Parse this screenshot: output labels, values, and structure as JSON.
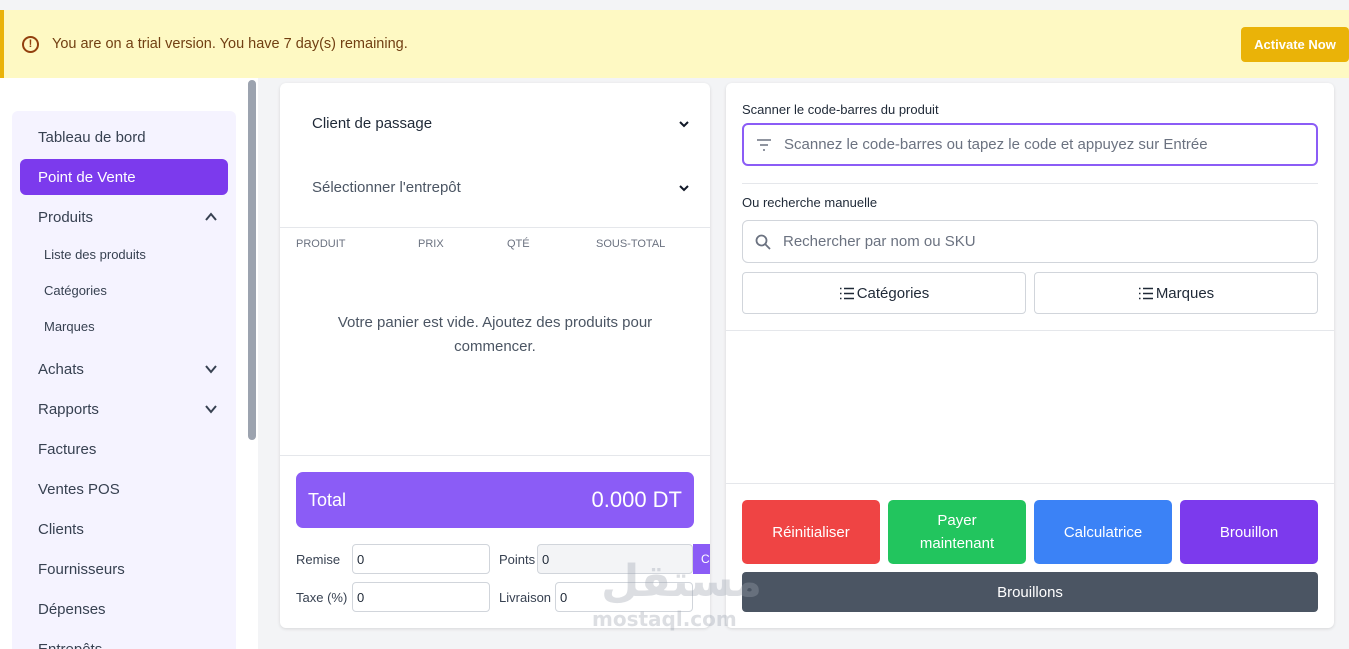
{
  "banner": {
    "icon": "alert-circle-icon",
    "message": "You are on a trial version. You have 7 day(s) remaining.",
    "activate_label": "Activate Now",
    "background": "#fef9c3",
    "accent": "#eab308"
  },
  "sidebar": {
    "items": [
      {
        "label": "Tableau de bord",
        "active": false
      },
      {
        "label": "Point de Vente",
        "active": true
      },
      {
        "label": "Produits",
        "expanded": true
      },
      {
        "label": "Achats",
        "expanded": false
      },
      {
        "label": "Rapports",
        "expanded": false
      },
      {
        "label": "Factures"
      },
      {
        "label": "Ventes POS"
      },
      {
        "label": "Clients"
      },
      {
        "label": "Fournisseurs"
      },
      {
        "label": "Dépenses"
      },
      {
        "label": "Entrepôts"
      }
    ],
    "subitems": [
      "Liste des produits",
      "Catégories",
      "Marques"
    ],
    "active_color": "#7c3aed"
  },
  "cart": {
    "customer_select": "Client de passage",
    "warehouse_select": "Sélectionner l'entrepôt",
    "columns": [
      "PRODUIT",
      "PRIX",
      "QTÉ",
      "SOUS-TOTAL"
    ],
    "empty_message": "Votre panier est vide. Ajoutez des produits pour commencer.",
    "total_label": "Total",
    "total_value": "0.000 DT",
    "fields": {
      "remise_label": "Remise",
      "remise_value": "0",
      "points_label": "Points",
      "points_value": "0",
      "convert_label": "Conv",
      "taxe_label": "Taxe (%)",
      "taxe_value": "0",
      "livraison_label": "Livraison",
      "livraison_value": "0"
    }
  },
  "product_panel": {
    "scan_label": "Scanner le code-barres du produit",
    "scan_placeholder": "Scannez le code-barres ou tapez le code et appuyez sur Entrée",
    "manual_label": "Ou recherche manuelle",
    "search_placeholder": "Rechercher par nom ou SKU",
    "categories_label": "Catégories",
    "brands_label": "Marques"
  },
  "actions": {
    "reset": {
      "label": "Réinitialiser",
      "color": "#ef4444"
    },
    "pay": {
      "label": "Payer maintenant",
      "color": "#22c55e"
    },
    "calc": {
      "label": "Calculatrice",
      "color": "#3b82f6"
    },
    "draft": {
      "label": "Brouillon",
      "color": "#7c3aed"
    },
    "drafts_label": "Brouillons",
    "drafts_color": "#4b5563"
  },
  "watermark": {
    "arabic": "مستقل",
    "latin": "mostaql.com"
  }
}
